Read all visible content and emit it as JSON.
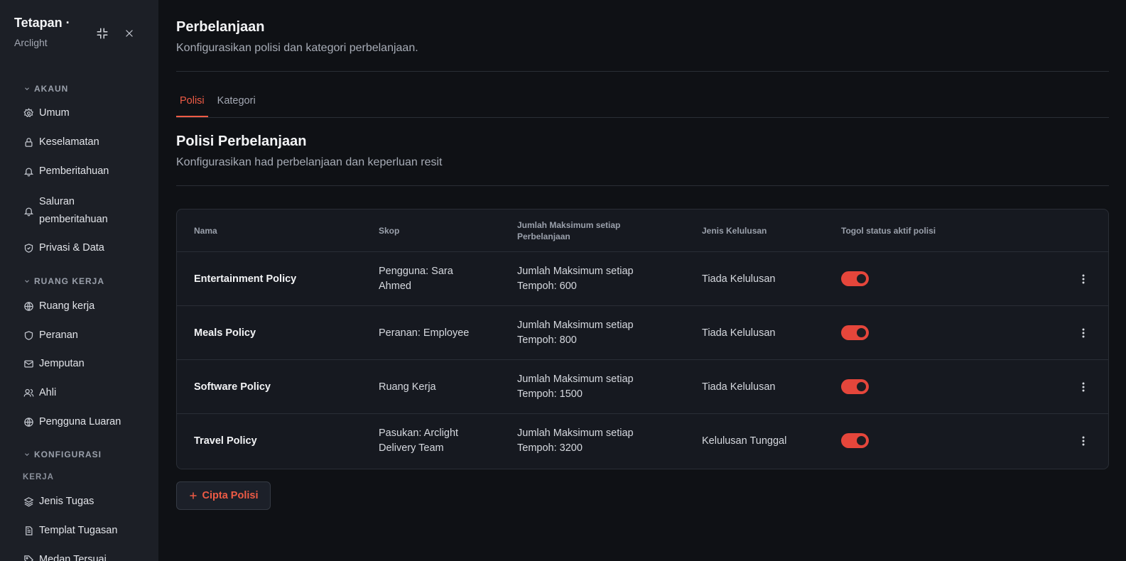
{
  "sidebar": {
    "title": "Tetapan ·",
    "subtitle": "Arclight",
    "sections": [
      {
        "label": "AKAUN"
      },
      {
        "label": "RUANG KERJA"
      },
      {
        "label": "KONFIGURASI"
      }
    ],
    "subsection": "KERJA",
    "items": [
      {
        "label": "Umum",
        "icon": "gear-icon"
      },
      {
        "label": "Keselamatan",
        "icon": "lock-icon"
      },
      {
        "label": "Pemberitahuan",
        "icon": "bell-icon"
      },
      {
        "label": "Saluran pemberitahuan",
        "icon": "bell-icon"
      },
      {
        "label": "Privasi & Data",
        "icon": "shield-check-icon"
      },
      {
        "label": "Ruang kerja",
        "icon": "globe-icon"
      },
      {
        "label": "Peranan",
        "icon": "shield-icon"
      },
      {
        "label": "Jemputan",
        "icon": "mail-icon"
      },
      {
        "label": "Ahli",
        "icon": "users-icon"
      },
      {
        "label": "Pengguna Luaran",
        "icon": "globe-icon"
      },
      {
        "label": "Jenis Tugas",
        "icon": "layers-icon"
      },
      {
        "label": "Templat Tugasan",
        "icon": "file-text-icon"
      },
      {
        "label": "Medan Tersuai",
        "icon": "tag-icon"
      }
    ]
  },
  "page": {
    "title": "Perbelanjaan",
    "description": "Konfigurasikan polisi dan kategori perbelanjaan."
  },
  "tabs": [
    {
      "label": "Polisi",
      "active": true
    },
    {
      "label": "Kategori",
      "active": false
    }
  ],
  "section": {
    "title": "Polisi Perbelanjaan",
    "description": "Konfigurasikan had perbelanjaan dan keperluan resit"
  },
  "table": {
    "headers": [
      "Nama",
      "Skop",
      "Jumlah Maksimum setiap Perbelanjaan",
      "Jenis Kelulusan",
      "Togol status aktif polisi"
    ],
    "rows": [
      {
        "name": "Entertainment Policy",
        "scope": "Pengguna: Sara Ahmed",
        "max": "Jumlah Maksimum setiap Tempoh: 600",
        "approval": "Tiada Kelulusan",
        "active": true
      },
      {
        "name": "Meals Policy",
        "scope": "Peranan: Employee",
        "max": "Jumlah Maksimum setiap Tempoh: 800",
        "approval": "Tiada Kelulusan",
        "active": true
      },
      {
        "name": "Software Policy",
        "scope": "Ruang Kerja",
        "max": "Jumlah Maksimum setiap Tempoh: 1500",
        "approval": "Tiada Kelulusan",
        "active": true
      },
      {
        "name": "Travel Policy",
        "scope": "Pasukan: Arclight Delivery Team",
        "max": "Jumlah Maksimum setiap Tempoh: 3200",
        "approval": "Kelulusan Tunggal",
        "active": true
      }
    ]
  },
  "create_button": {
    "label": "Cipta Polisi",
    "icon": "plus-icon"
  },
  "colors": {
    "accent": "#ef5b45",
    "toggle_on": "#e5463b",
    "background": "#0f1115",
    "sidebar": "#1c1f26"
  }
}
